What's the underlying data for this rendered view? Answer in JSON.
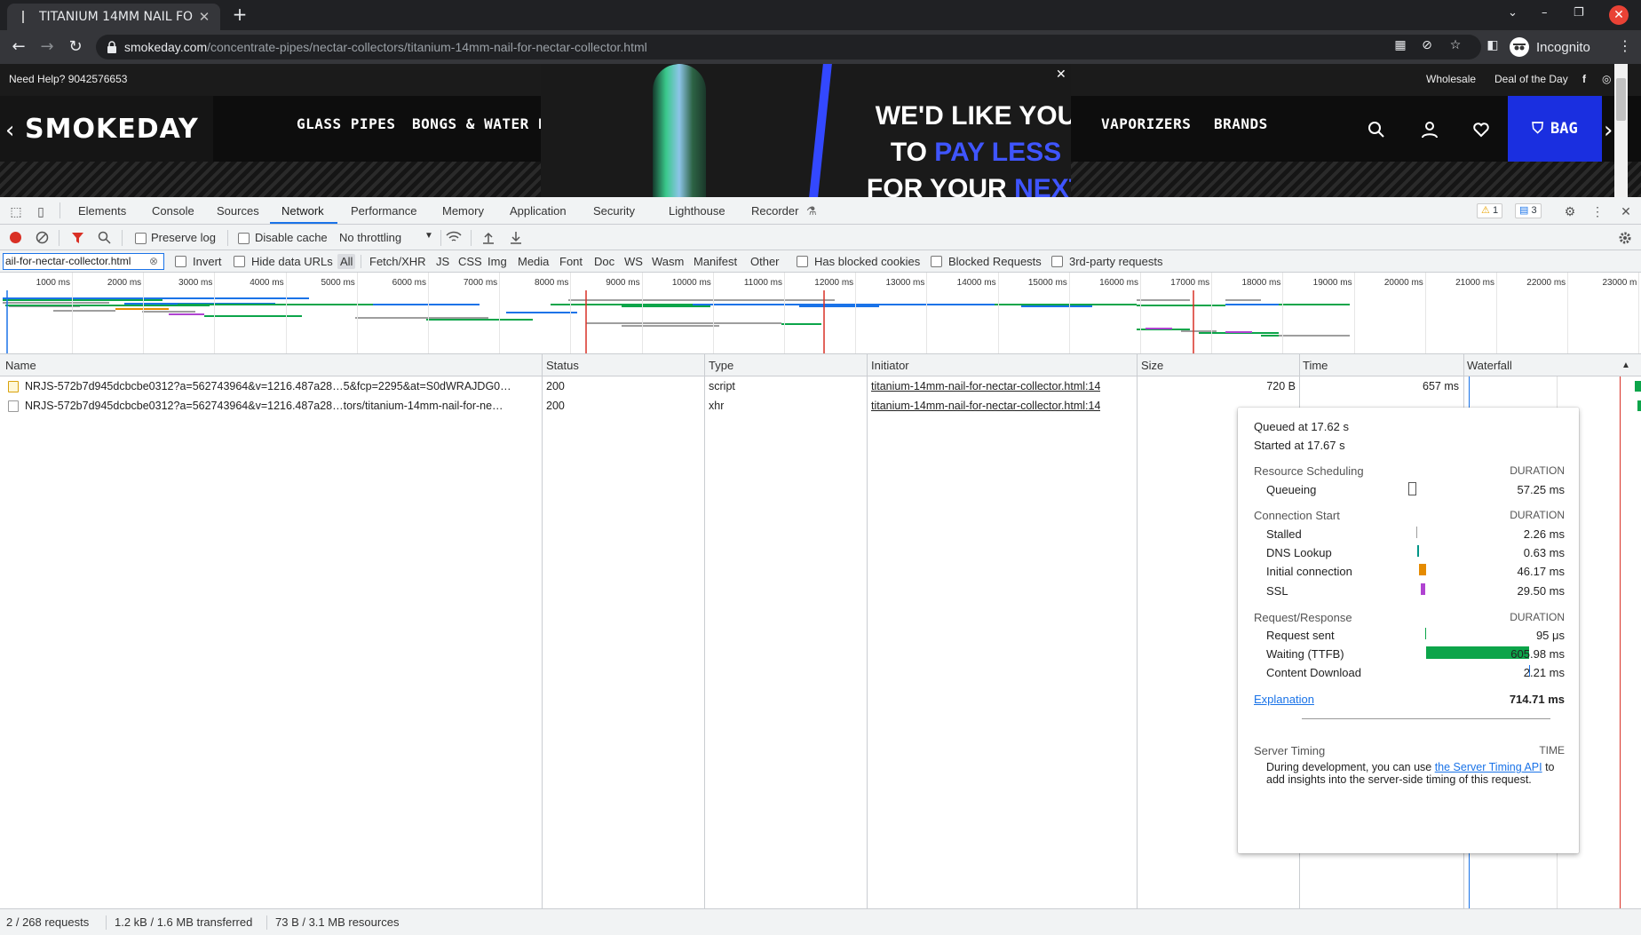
{
  "browser": {
    "tab_title": "TITANIUM 14MM NAIL FO",
    "url_host": "smokeday.com",
    "url_path": "/concentrate-pipes/nectar-collectors/titanium-14mm-nail-for-nectar-collector.html",
    "profile": "Incognito"
  },
  "site": {
    "need_help": "Need Help? 9042576653",
    "top_links": [
      "Wholesale",
      "Deal of the Day"
    ],
    "logo": "SMOKEDAY",
    "nav": [
      "GLASS PIPES",
      "BONGS & WATER PIP",
      "VAPORIZERS",
      "BRANDS"
    ],
    "promo_line1": "WE'D LIKE YOU",
    "promo_line2a": "TO ",
    "promo_line2b": "PAY LESS",
    "promo_line3a": "FOR YOUR ",
    "promo_line3b": "NEXT",
    "bag": "BAG"
  },
  "devtools": {
    "tabs": [
      "Elements",
      "Console",
      "Sources",
      "Network",
      "Performance",
      "Memory",
      "Application",
      "Security",
      "Lighthouse",
      "Recorder"
    ],
    "warn_count": "1",
    "msg_count": "3",
    "preserve_log": "Preserve log",
    "disable_cache": "Disable cache",
    "throttling": "No throttling",
    "filter_value": "ail-for-nectar-collector.html",
    "invert": "Invert",
    "hide_data_urls": "Hide data URLs",
    "types": [
      "All",
      "Fetch/XHR",
      "JS",
      "CSS",
      "Img",
      "Media",
      "Font",
      "Doc",
      "WS",
      "Wasm",
      "Manifest",
      "Other"
    ],
    "has_blocked_cookies": "Has blocked cookies",
    "blocked_requests": "Blocked Requests",
    "third_party": "3rd-party requests",
    "overview_ticks": [
      "1000 ms",
      "2000 ms",
      "3000 ms",
      "4000 ms",
      "5000 ms",
      "6000 ms",
      "7000 ms",
      "8000 ms",
      "9000 ms",
      "10000 ms",
      "11000 ms",
      "12000 ms",
      "13000 ms",
      "14000 ms",
      "15000 ms",
      "16000 ms",
      "17000 ms",
      "18000 ms",
      "19000 ms",
      "20000 ms",
      "21000 ms",
      "22000 ms",
      "23000 m"
    ],
    "columns": [
      "Name",
      "Status",
      "Type",
      "Initiator",
      "Size",
      "Time",
      "Waterfall"
    ],
    "rows": [
      {
        "name": "NRJS-572b7d945dcbcbe0312?a=562743964&v=1216.487a28…5&fcp=2295&at=S0dWRAJDG0…",
        "status": "200",
        "type": "script",
        "initiator": "titanium-14mm-nail-for-nectar-collector.html:14",
        "size": "720 B",
        "time": "657 ms"
      },
      {
        "name": "NRJS-572b7d945dcbcbe0312?a=562743964&v=1216.487a28…tors/titanium-14mm-nail-for-ne…",
        "status": "200",
        "type": "xhr",
        "initiator": "titanium-14mm-nail-for-nectar-collector.html:14",
        "size": "",
        "time": ""
      }
    ],
    "timing": {
      "queued_at": "Queued at 17.62 s",
      "started_at": "Started at 17.67 s",
      "sched_header": "Resource Scheduling",
      "conn_header": "Connection Start",
      "req_header": "Request/Response",
      "duration": "DURATION",
      "queueing_label": "Queueing",
      "queueing": "57.25 ms",
      "stalled_label": "Stalled",
      "stalled": "2.26 ms",
      "dns_label": "DNS Lookup",
      "dns": "0.63 ms",
      "initial_label": "Initial connection",
      "initial": "46.17 ms",
      "ssl_label": "SSL",
      "ssl": "29.50 ms",
      "sent_label": "Request sent",
      "sent": "95 μs",
      "ttfb_label": "Waiting (TTFB)",
      "ttfb": "605.98 ms",
      "download_label": "Content Download",
      "download": "2.21 ms",
      "explanation": "Explanation",
      "total": "714.71 ms",
      "server_timing": "Server Timing",
      "time_hdr": "TIME",
      "server_note_pre": "During development, you can use ",
      "server_note_link": "the Server Timing API",
      "server_note_post": " to add insights into the server-side timing of this request."
    },
    "status": {
      "requests": "2 / 268 requests",
      "transferred": "1.2 kB / 1.6 MB transferred",
      "resources": "73 B / 3.1 MB resources"
    }
  },
  "colors": {
    "accent": "#1a73e8",
    "ttfb": "#0ca54a",
    "ssl": "#b043d1",
    "connect": "#e58b00",
    "dns": "#009688",
    "brand_blue": "#1a2fe0"
  }
}
